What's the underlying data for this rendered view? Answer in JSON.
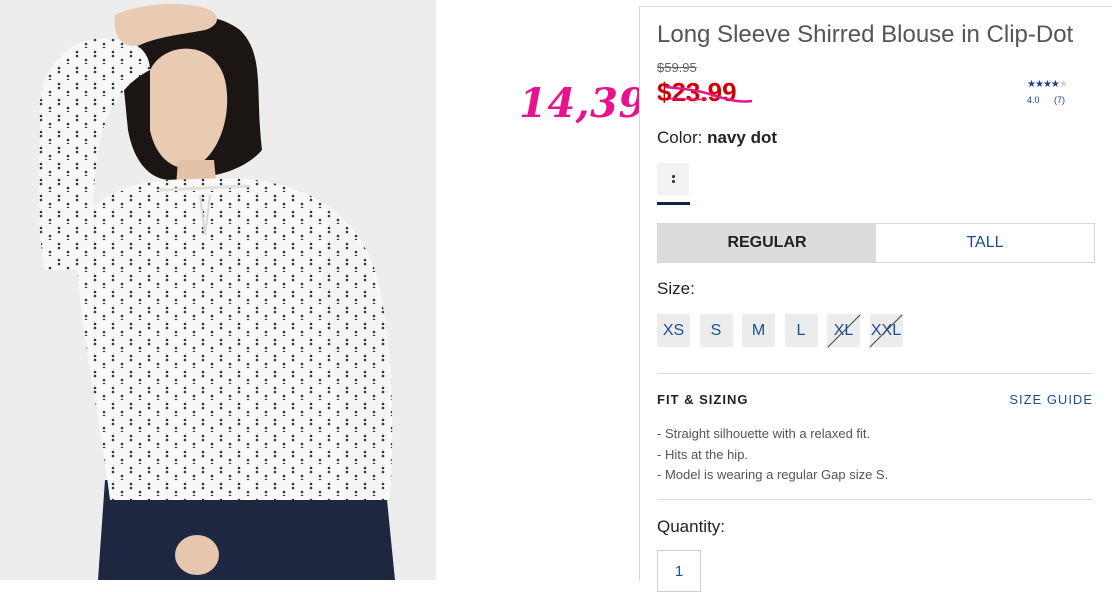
{
  "product": {
    "title": "Long Sleeve Shirred Blouse in Clip-Dot",
    "original_price": "$59.95",
    "sale_price": "$23.99",
    "handwritten_price": "14,39",
    "rating": {
      "value": "4.0",
      "count": "(7)",
      "stars": 4,
      "max_stars": 5
    },
    "color_label": "Color:",
    "color_value": "navy dot",
    "fit_options": [
      "REGULAR",
      "TALL"
    ],
    "fit_selected": "REGULAR",
    "size_label": "Size:",
    "sizes": [
      "XS",
      "S",
      "M",
      "L",
      "XL",
      "XXL"
    ],
    "sizes_unavailable": [
      "XL",
      "XXL"
    ],
    "fit_heading": "FIT & SIZING",
    "size_guide": "SIZE GUIDE",
    "fit_details": [
      "- Straight silhouette with a relaxed fit.",
      "- Hits at the hip.",
      "- Model is wearing a regular Gap size S."
    ],
    "quantity_label": "Quantity:",
    "quantity_value": "1"
  },
  "colors": {
    "sale_red": "#d00000",
    "handwriting_pink": "#e8128c",
    "link_blue": "#1c4f8c",
    "star_blue": "#1c3f94",
    "navy": "#122344"
  },
  "icons": [
    "star-icon",
    "navy-dot-swatch"
  ]
}
